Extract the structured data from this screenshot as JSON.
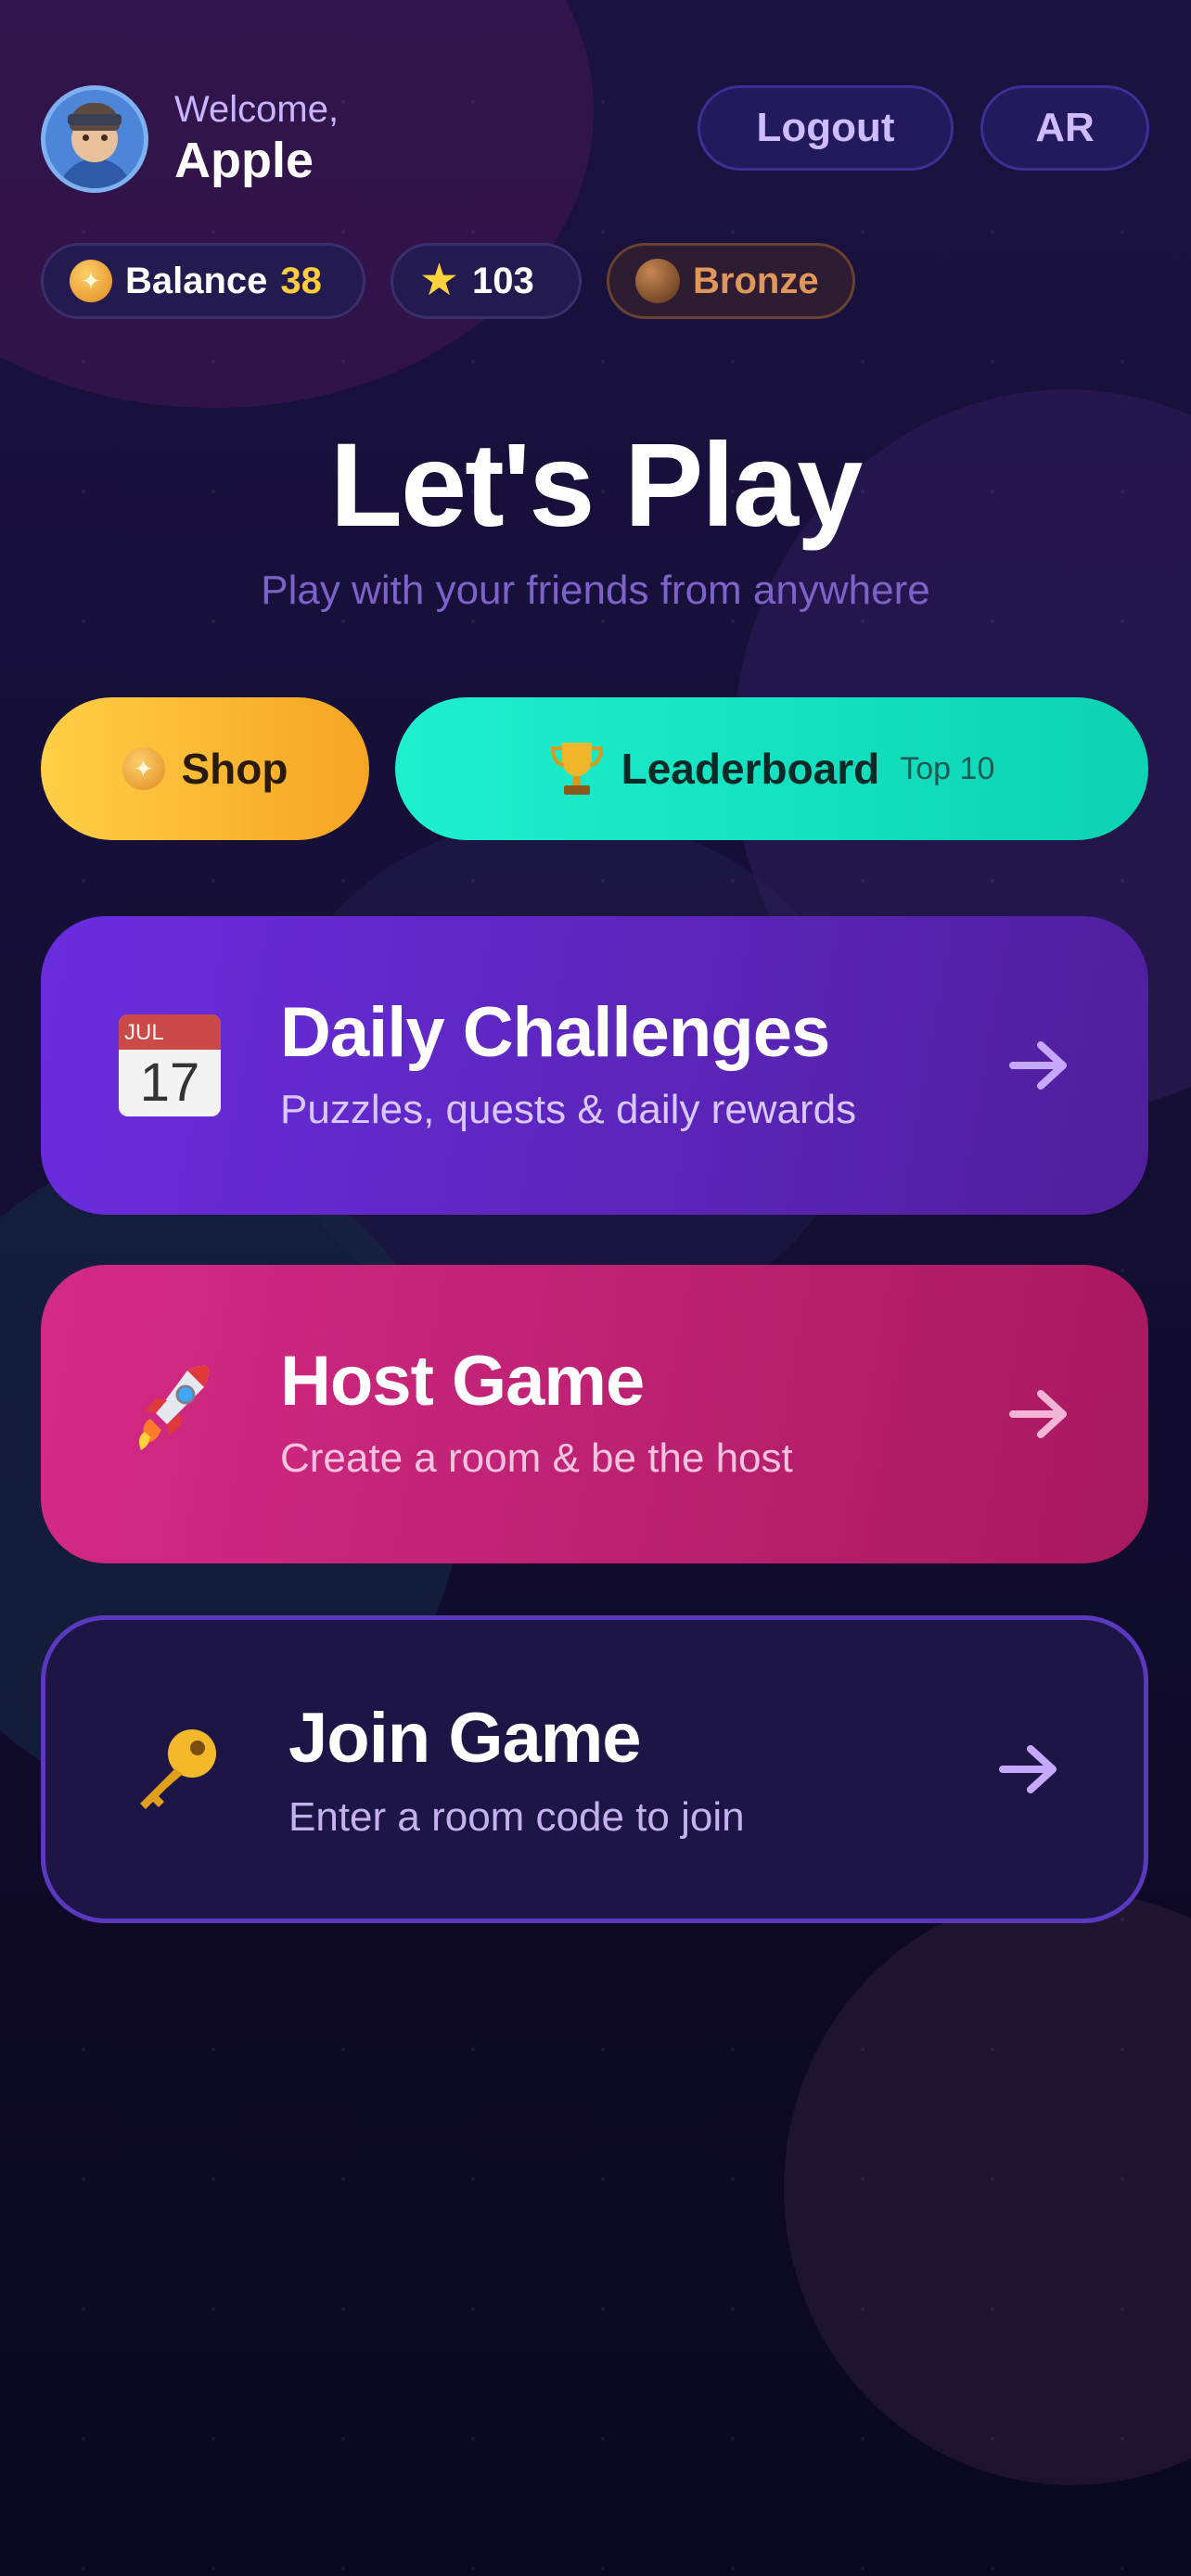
{
  "header": {
    "welcome_label": "Welcome,",
    "username": "Apple",
    "logout_label": "Logout",
    "language_label": "AR"
  },
  "stats": {
    "balance_label": "Balance",
    "balance_value": "38",
    "stars_value": "103",
    "rank_label": "Bronze"
  },
  "hero": {
    "title": "Let's Play",
    "subtitle": "Play with your friends from anywhere"
  },
  "quick_actions": {
    "shop_label": "Shop",
    "leaderboard_label": "Leaderboard",
    "leaderboard_sub": "Top 10"
  },
  "cards": [
    {
      "title": "Daily Challenges",
      "subtitle": "Puzzles, quests & daily rewards",
      "icon": "calendar-icon",
      "calendar_month": "JUL",
      "calendar_day": "17"
    },
    {
      "title": "Host Game",
      "subtitle": "Create a room & be the host",
      "icon": "rocket-icon"
    },
    {
      "title": "Join Game",
      "subtitle": "Enter a room code to join",
      "icon": "key-icon"
    }
  ],
  "colors": {
    "background": "#150f36",
    "accent_purple": "#6a2ddf",
    "accent_pink": "#d42a86",
    "shop_yellow": "#ffcf46",
    "leaderboard_teal": "#1ef0cf",
    "balance_gold": "#ffcc3a",
    "bronze": "#e0975a"
  }
}
